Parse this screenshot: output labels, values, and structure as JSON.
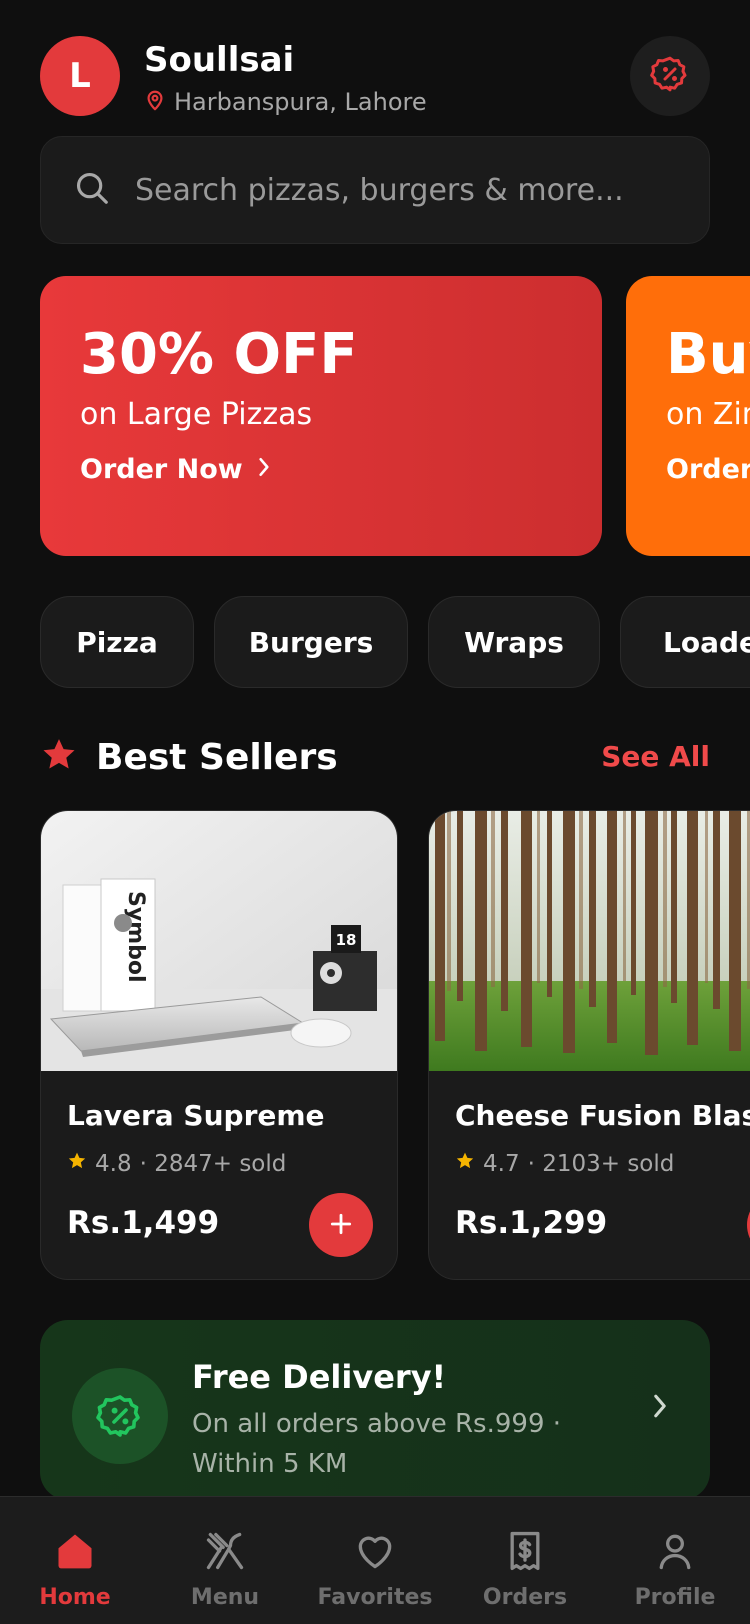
{
  "header": {
    "avatar_initial": "L",
    "user_name": "Soullsai",
    "location": "Harbanspura, Lahore"
  },
  "search": {
    "placeholder": "Search pizzas, burgers & more..."
  },
  "banners": [
    {
      "title": "30% OFF",
      "subtitle": "on Large Pizzas",
      "cta": "Order Now",
      "color": "#e33a3c"
    },
    {
      "title": "Buy",
      "subtitle": "on Zin",
      "cta": "Order",
      "color": "#ff6e0a"
    }
  ],
  "categories": [
    "Pizza",
    "Burgers",
    "Wraps",
    "Loaded"
  ],
  "best_sellers": {
    "title": "Best Sellers",
    "see_all": "See All",
    "items": [
      {
        "name": "Lavera Supreme",
        "rating": "4.8",
        "sold": "· 2847+ sold",
        "price": "Rs.1,499",
        "image": "laptop-desk-photo"
      },
      {
        "name": "Cheese Fusion Blast",
        "rating": "4.7",
        "sold": "· 2103+ sold",
        "price": "Rs.1,299",
        "image": "forest-photo"
      }
    ]
  },
  "delivery": {
    "title": "Free Delivery!",
    "subtitle": "On all orders above Rs.999 · Within 5 KM"
  },
  "nav": {
    "items": [
      {
        "label": "Home",
        "icon": "home-icon",
        "active": true
      },
      {
        "label": "Menu",
        "icon": "utensils-icon",
        "active": false
      },
      {
        "label": "Favorites",
        "icon": "heart-icon",
        "active": false
      },
      {
        "label": "Orders",
        "icon": "receipt-icon",
        "active": false
      },
      {
        "label": "Profile",
        "icon": "user-icon",
        "active": false
      }
    ]
  },
  "colors": {
    "accent": "#e33a3c",
    "orange": "#ff6e0a",
    "star": "#f5b400",
    "green": "#22c55e"
  }
}
